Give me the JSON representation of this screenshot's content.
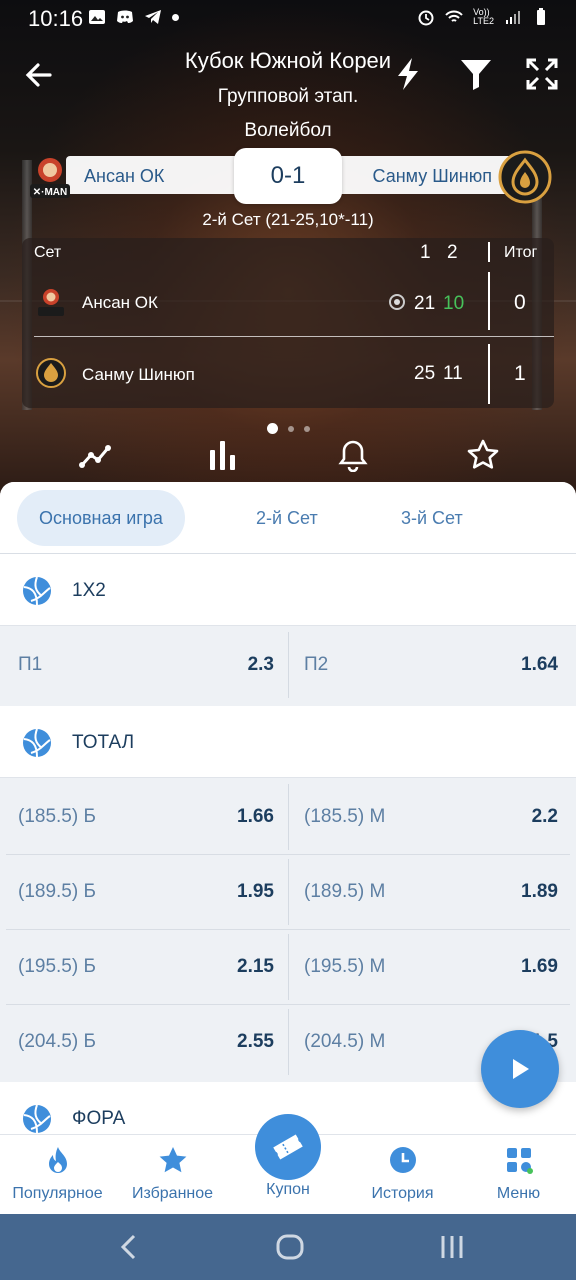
{
  "status_bar": {
    "time": "10:16",
    "network": "Vo))\nLTE2"
  },
  "header": {
    "title": "Кубок Южной Кореи",
    "subtitle": "Групповой этап.",
    "sport": "Волейбол"
  },
  "match": {
    "team1": "Ансан ОК",
    "team2": "Санму Шинюп",
    "score": "0-1",
    "set_info": "2-й Сет (21-25,10*-11)"
  },
  "score_table": {
    "header": {
      "set": "Сет",
      "col1": "1",
      "col2": "2",
      "total": "Итог"
    },
    "rows": [
      {
        "team": "Ансан ОК",
        "s1": "21",
        "s2": "10",
        "total": "0",
        "serving": true
      },
      {
        "team": "Санму Шинюп",
        "s1": "25",
        "s2": "11",
        "total": "1",
        "serving": false
      }
    ]
  },
  "tabs": [
    {
      "label": "Основная игра",
      "active": true
    },
    {
      "label": "2-й Сет",
      "active": false
    },
    {
      "label": "3-й Сет",
      "active": false
    }
  ],
  "markets": {
    "m1x2": {
      "title": "1Х2",
      "rows": [
        {
          "left": {
            "name": "П1",
            "odd": "2.3"
          },
          "right": {
            "name": "П2",
            "odd": "1.64"
          }
        }
      ]
    },
    "total": {
      "title": "ТОТАЛ",
      "rows": [
        {
          "left": {
            "name": "(185.5) Б",
            "odd": "1.66"
          },
          "right": {
            "name": "(185.5) М",
            "odd": "2.2"
          }
        },
        {
          "left": {
            "name": "(189.5) Б",
            "odd": "1.95"
          },
          "right": {
            "name": "(189.5) М",
            "odd": "1.89"
          }
        },
        {
          "left": {
            "name": "(195.5) Б",
            "odd": "2.15"
          },
          "right": {
            "name": "(195.5) М",
            "odd": "1.69"
          }
        },
        {
          "left": {
            "name": "(204.5) Б",
            "odd": "2.55"
          },
          "right": {
            "name": "(204.5) М",
            "odd": "1.5"
          }
        }
      ]
    },
    "fora": {
      "title": "ФОРА"
    }
  },
  "bottom_nav": {
    "popular": "Популярное",
    "favorites": "Избранное",
    "coupon": "Купон",
    "history": "История",
    "menu": "Меню"
  },
  "colors": {
    "accent": "#3f8edb",
    "text_dark": "#1c3d5e",
    "text_blue": "#3b73ad",
    "green": "#47c25a"
  }
}
